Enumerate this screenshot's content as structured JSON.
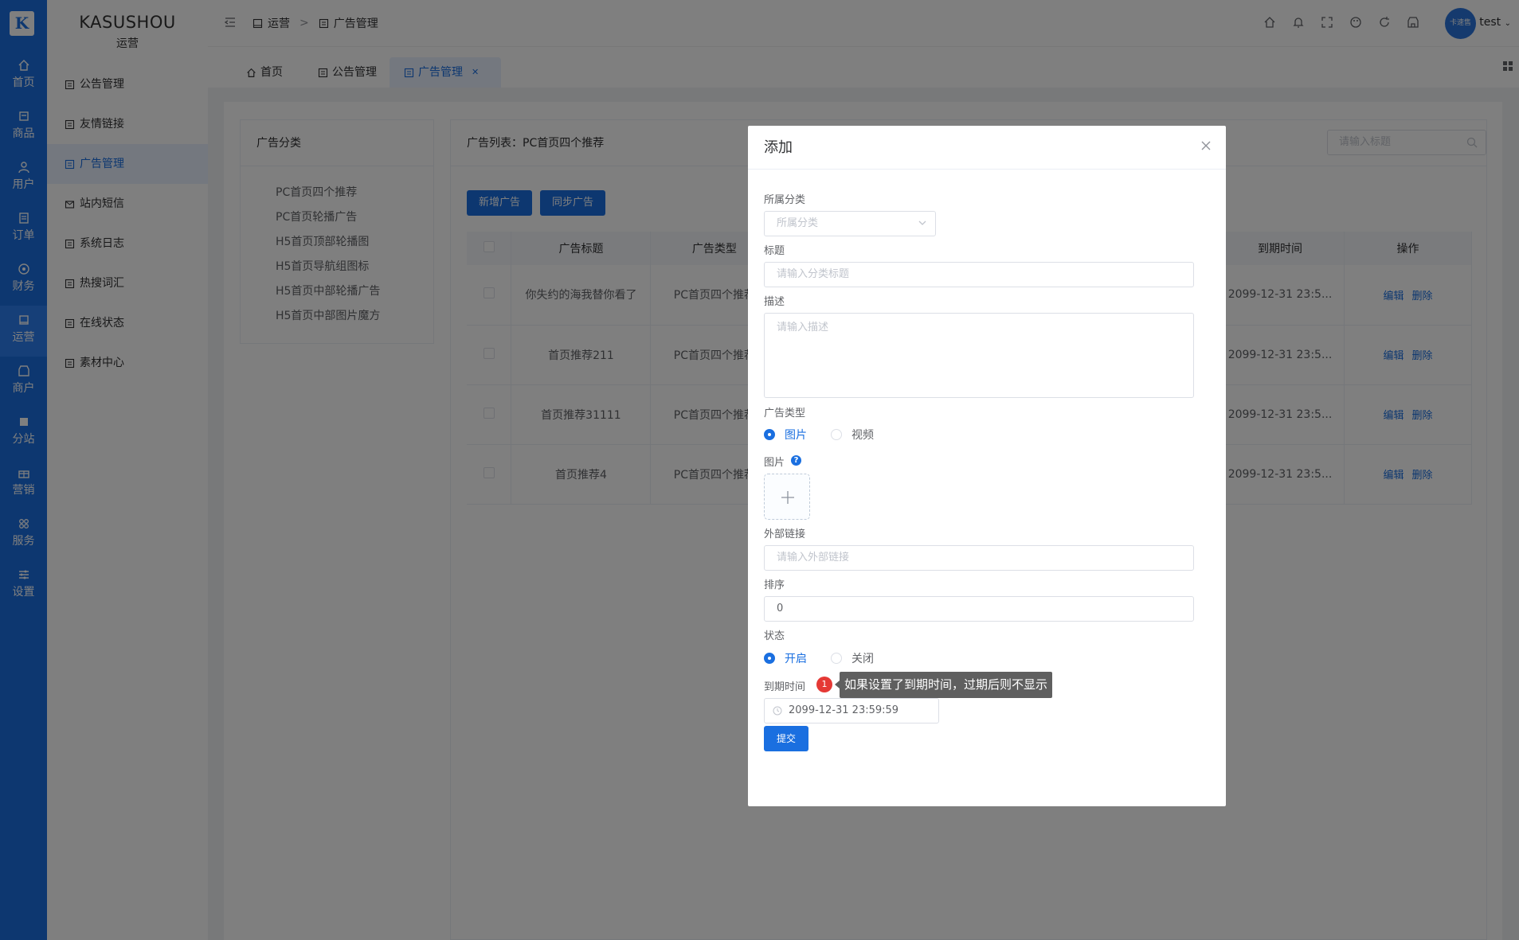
{
  "app": {
    "logo_text": "K",
    "brand_name": "KASUSHOU",
    "brand_sub": "运营",
    "user_name": "test",
    "avatar_text": "卡速售"
  },
  "rail": {
    "items": [
      {
        "label": "首页",
        "icon": "home-icon"
      },
      {
        "label": "商品",
        "icon": "goods-icon"
      },
      {
        "label": "用户",
        "icon": "user-icon"
      },
      {
        "label": "订单",
        "icon": "order-icon"
      },
      {
        "label": "财务",
        "icon": "finance-icon"
      },
      {
        "label": "运营",
        "icon": "operation-icon"
      },
      {
        "label": "商户",
        "icon": "merchant-icon"
      },
      {
        "label": "分站",
        "icon": "substation-icon"
      },
      {
        "label": "营销",
        "icon": "gift-icon"
      },
      {
        "label": "服务",
        "icon": "service-icon"
      },
      {
        "label": "设置",
        "icon": "settings-icon"
      }
    ]
  },
  "sidebar": {
    "items": [
      {
        "label": "公告管理"
      },
      {
        "label": "友情链接"
      },
      {
        "label": "广告管理"
      },
      {
        "label": "站内短信"
      },
      {
        "label": "系统日志"
      },
      {
        "label": "热搜词汇"
      },
      {
        "label": "在线状态"
      },
      {
        "label": "素材中心"
      }
    ]
  },
  "breadcrumb": {
    "parent": "运营",
    "separator": ">",
    "current": "广告管理"
  },
  "tabs": [
    {
      "label": "首页"
    },
    {
      "label": "公告管理"
    },
    {
      "label": "广告管理"
    }
  ],
  "categories": {
    "title": "广告分类",
    "items": [
      "PC首页四个推荐",
      "PC首页轮播广告",
      "H5首页顶部轮播图",
      "H5首页导航组图标",
      "H5首页中部轮播广告",
      "H5首页中部图片魔方"
    ]
  },
  "list": {
    "title": "广告列表：PC首页四个推荐",
    "search_placeholder": "请输入标题",
    "add_button": "新增广告",
    "sync_button": "同步广告",
    "columns": [
      "广告标题",
      "广告类型",
      "到期时间",
      "操作"
    ],
    "edit_label": "编辑",
    "delete_label": "删除",
    "rows": [
      {
        "title": "你失约的海我替你看了",
        "type": "PC首页四个推荐",
        "expire": "2099-12-31 23:5..."
      },
      {
        "title": "首页推荐211",
        "type": "PC首页四个推荐",
        "expire": "2099-12-31 23:5..."
      },
      {
        "title": "首页推荐31111",
        "type": "PC首页四个推荐",
        "expire": "2099-12-31 23:5..."
      },
      {
        "title": "首页推荐4",
        "type": "PC首页四个推荐",
        "expire": "2099-12-31 23:5..."
      }
    ]
  },
  "modal": {
    "title": "添加",
    "category_label": "所属分类",
    "category_placeholder": "所属分类",
    "title_label": "标题",
    "title_placeholder": "请输入分类标题",
    "desc_label": "描述",
    "desc_placeholder": "请输入描述",
    "ad_type_label": "广告类型",
    "ad_type_options": [
      "图片",
      "视频"
    ],
    "ad_type_selected": "图片",
    "image_label": "图片",
    "link_label": "外部链接",
    "link_placeholder": "请输入外部链接",
    "sort_label": "排序",
    "sort_value": "0",
    "status_label": "状态",
    "status_options": [
      "开启",
      "关闭"
    ],
    "status_selected": "开启",
    "expire_label": "到期时间",
    "expire_value": "2099-12-31 23:59:59",
    "submit_label": "提交",
    "badge_number": "1",
    "tooltip": "如果设置了到期时间，过期后则不显示"
  },
  "colors": {
    "primary": "#1a6fe0",
    "rail": "#1a6fe0",
    "badge": "#e53935",
    "tooltip_bg": "#5f5f5f"
  }
}
